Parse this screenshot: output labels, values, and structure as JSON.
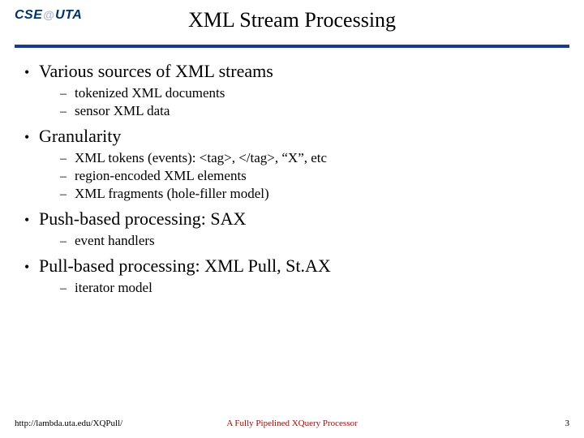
{
  "logo": {
    "left": "CSE",
    "at": "@",
    "right": "UTA"
  },
  "title": "XML Stream Processing",
  "bullets": [
    {
      "text": "Various sources of XML streams",
      "sub": [
        "tokenized XML documents",
        "sensor XML data"
      ]
    },
    {
      "text": "Granularity",
      "sub": [
        "XML tokens (events):  <tag>, </tag>, “X”, etc",
        "region-encoded XML elements",
        "XML fragments (hole-filler model)"
      ]
    },
    {
      "text": "Push-based processing:  SAX",
      "sub": [
        "event handlers"
      ]
    },
    {
      "text": "Pull-based processing:  XML Pull, St.AX",
      "sub": [
        "iterator model"
      ]
    }
  ],
  "footer": {
    "left": "http://lambda.uta.edu/XQPull/",
    "center": "A Fully Pipelined XQuery Processor",
    "right": "3"
  }
}
